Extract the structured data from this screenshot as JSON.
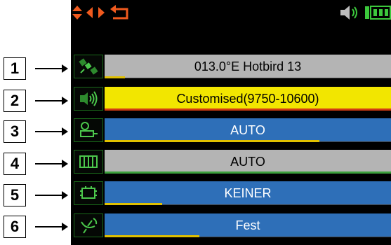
{
  "callouts": [
    "1",
    "2",
    "3",
    "4",
    "5",
    "6"
  ],
  "topbar": {
    "icons": [
      "up-down-arrows-icon",
      "left-right-arrows-icon",
      "back-return-icon",
      "speaker-volume-icon",
      "battery-icon"
    ],
    "colors": {
      "nav": "#f05a1e",
      "status": "#3cc83c"
    }
  },
  "rows": [
    {
      "icon": "satellite-icon",
      "value": "013.0°E Hotbird 13",
      "bg": "#b4b4b4",
      "text": "#000000",
      "gauge": 0.07,
      "gauge_color": "#e0c000"
    },
    {
      "icon": "lnb-signal-icon",
      "value": "Customised(9750-10600)",
      "bg": "#f2e600",
      "text": "#000000",
      "gauge": 1.0,
      "gauge_color": "#d23c14"
    },
    {
      "icon": "diseqc-switch-icon",
      "value": "AUTO",
      "bg": "#2e6fb8",
      "text": "#ffffff",
      "gauge": 0.75,
      "gauge_color": "#e0c000"
    },
    {
      "icon": "multiswitch-icon",
      "value": "AUTO",
      "bg": "#b4b4b4",
      "text": "#000000",
      "gauge": 1.0,
      "gauge_color": "#3ca03c"
    },
    {
      "icon": "tuner-chip-icon",
      "value": "KEINER",
      "bg": "#2e6fb8",
      "text": "#ffffff",
      "gauge": 0.2,
      "gauge_color": "#e0c000"
    },
    {
      "icon": "dish-motor-icon",
      "value": "Fest",
      "bg": "#2e6fb8",
      "text": "#ffffff",
      "gauge": 0.33,
      "gauge_color": "#e0c000"
    }
  ]
}
